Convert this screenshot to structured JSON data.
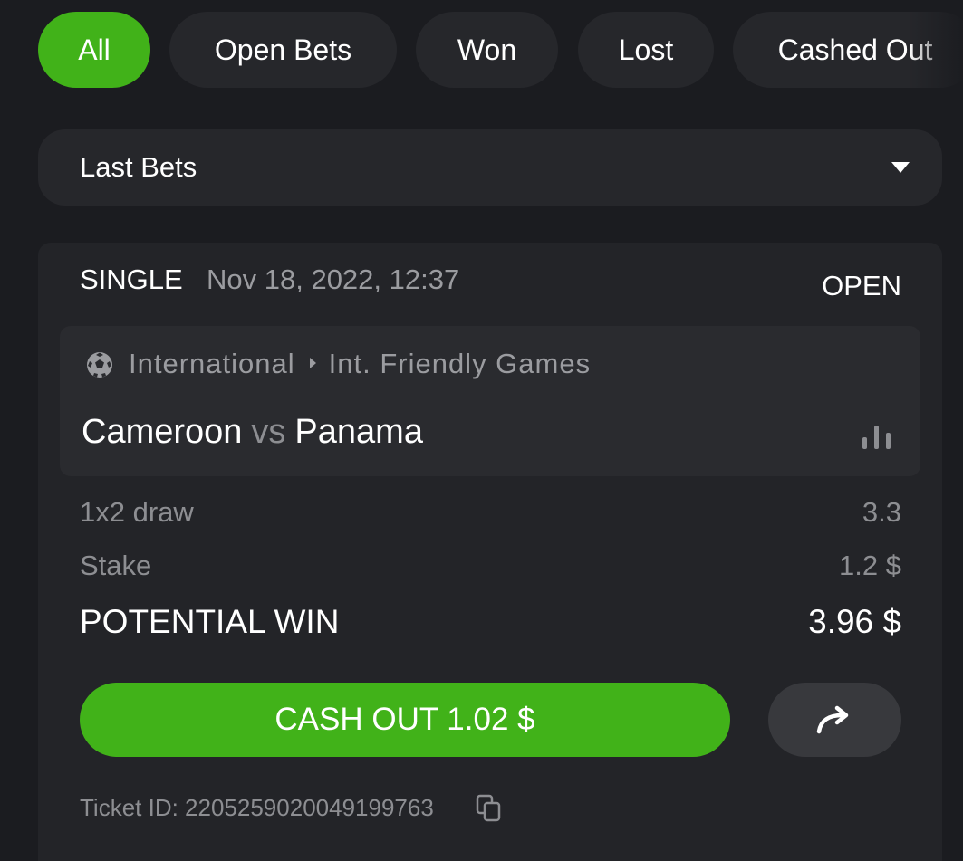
{
  "filters": {
    "tabs": [
      {
        "label": "All",
        "active": true
      },
      {
        "label": "Open Bets",
        "active": false
      },
      {
        "label": "Won",
        "active": false
      },
      {
        "label": "Lost",
        "active": false
      },
      {
        "label": "Cashed Out",
        "active": false
      }
    ]
  },
  "period_select": {
    "value": "Last Bets",
    "icon": "caret-down-icon"
  },
  "bet": {
    "type": "SINGLE",
    "datetime": "Nov 18, 2022, 12:37",
    "status": "OPEN",
    "event": {
      "sport_icon": "soccer-ball-icon",
      "category": "International",
      "league": "Int. Friendly Games",
      "home_team": "Cameroon",
      "vs": "vs",
      "away_team": "Panama",
      "stats_icon": "stats-bars-icon"
    },
    "selection": {
      "label": "1x2 draw",
      "odds": "3.3"
    },
    "stake": {
      "label": "Stake",
      "value": "1.2 $"
    },
    "potential_win": {
      "label": "POTENTIAL WIN",
      "value": "3.96 $"
    },
    "cashout_label": "CASH OUT 1.02 $",
    "share_icon": "share-arrow-icon",
    "ticket_id": "Ticket ID: 2205259020049199763",
    "copy_icon": "copy-icon"
  },
  "colors": {
    "background": "#1b1c20",
    "card": "#232428",
    "accent_green": "#41b219",
    "muted_text": "#8d8e92"
  }
}
